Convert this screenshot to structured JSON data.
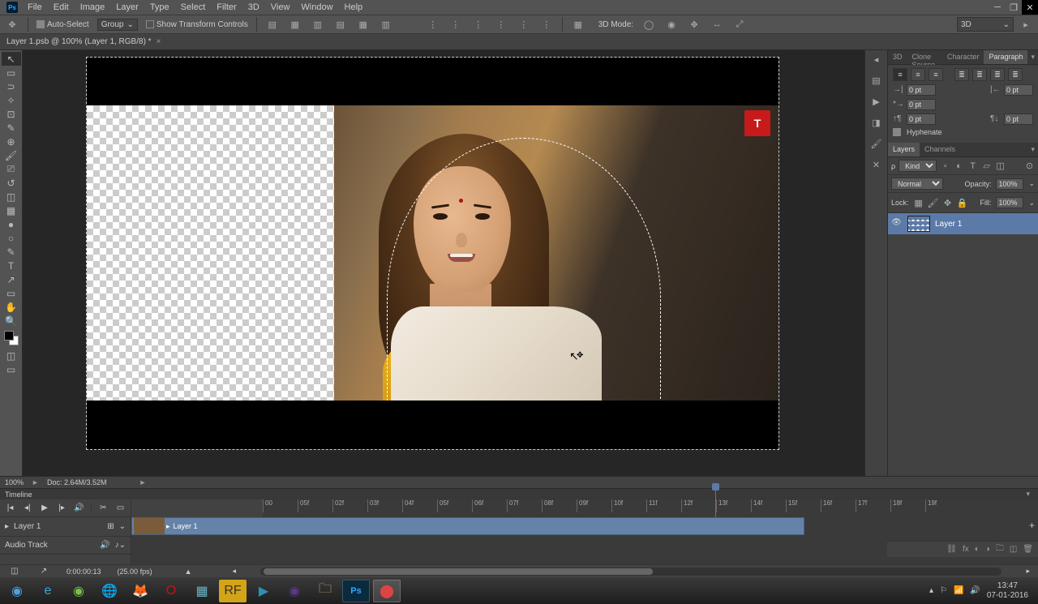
{
  "menus": [
    "File",
    "Edit",
    "Image",
    "Layer",
    "Type",
    "Select",
    "Filter",
    "3D",
    "View",
    "Window",
    "Help"
  ],
  "options": {
    "autoSelect": "Auto-Select",
    "group": "Group",
    "showTransform": "Show Transform Controls",
    "mode3d": "3D Mode:"
  },
  "docTab": "Layer 1.psb @ 100% (Layer 1, RGB/8) *",
  "rightTabs1": [
    "3D",
    "Clone Source",
    "Character",
    "Paragraph"
  ],
  "paragraph": {
    "indentLeft": "0 pt",
    "indentRight": "0 pt",
    "indentFirst": "0 pt",
    "spaceBefore": "0 pt",
    "spaceAfter": "0 pt",
    "hyphenate": "Hyphenate"
  },
  "layersTabs": [
    "Layers",
    "Channels"
  ],
  "layers": {
    "kind": "Kind",
    "blend": "Normal",
    "opacityLabel": "Opacity:",
    "opacity": "100%",
    "lockLabel": "Lock:",
    "fillLabel": "Fill:",
    "fill": "100%",
    "layerName": "Layer 1"
  },
  "rightStrip": {
    "mode3d": "3D"
  },
  "status": {
    "zoom": "100%",
    "doc": "Doc: 2.64M/3.52M"
  },
  "timeline": {
    "title": "Timeline",
    "trackName": "Layer 1",
    "clipName": "Layer 1",
    "audioTrack": "Audio Track",
    "time": "0:00:00:13",
    "fps": "(25.00 fps)",
    "ticks": [
      "00",
      "05f",
      "02f",
      "03f",
      "04f",
      "05f",
      "06f",
      "07f",
      "08f",
      "09f",
      "10f",
      "11f",
      "12f",
      "13f",
      "14f",
      "15f",
      "16f",
      "17f",
      "18f",
      "19f"
    ]
  },
  "taskbar": {
    "time": "13:47",
    "date": "07-01-2016"
  },
  "photo": {
    "logo": "T"
  }
}
